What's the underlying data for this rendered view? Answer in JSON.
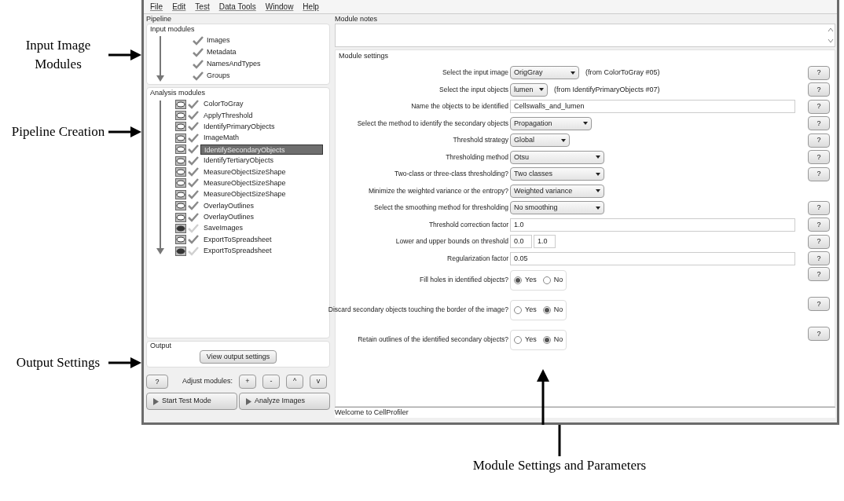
{
  "annotations": [
    {
      "text": "Input Image Modules"
    },
    {
      "text": "Pipeline Creation"
    },
    {
      "text": "Output Settings"
    },
    {
      "text": "Module Settings and Parameters"
    }
  ],
  "menu": [
    "File",
    "Edit",
    "Test",
    "Data Tools",
    "Window",
    "Help"
  ],
  "pipeline": {
    "title": "Pipeline",
    "input_title": "Input modules",
    "input_modules": [
      {
        "name": "Images"
      },
      {
        "name": "Metadata"
      },
      {
        "name": "NamesAndTypes"
      },
      {
        "name": "Groups"
      }
    ],
    "analysis_title": "Analysis modules",
    "analysis_modules": [
      {
        "name": "ColorToGray",
        "selected": false,
        "enabled": true
      },
      {
        "name": "ApplyThreshold",
        "selected": false,
        "enabled": true
      },
      {
        "name": "IdentifyPrimaryObjects",
        "selected": false,
        "enabled": true
      },
      {
        "name": "ImageMath",
        "selected": false,
        "enabled": true
      },
      {
        "name": "IdentifySecondaryObjects",
        "selected": true,
        "enabled": true
      },
      {
        "name": "IdentifyTertiaryObjects",
        "selected": false,
        "enabled": true
      },
      {
        "name": "MeasureObjectSizeShape",
        "selected": false,
        "enabled": true
      },
      {
        "name": "MeasureObjectSizeShape",
        "selected": false,
        "enabled": true
      },
      {
        "name": "MeasureObjectSizeShape",
        "selected": false,
        "enabled": true
      },
      {
        "name": "OverlayOutlines",
        "selected": false,
        "enabled": true
      },
      {
        "name": "OverlayOutlines",
        "selected": false,
        "enabled": true
      },
      {
        "name": "SaveImages",
        "selected": false,
        "enabled": false
      },
      {
        "name": "ExportToSpreadsheet",
        "selected": false,
        "enabled": true
      },
      {
        "name": "ExportToSpreadsheet",
        "selected": false,
        "enabled": false
      }
    ]
  },
  "output": {
    "title": "Output",
    "button": "View output settings"
  },
  "adjust": {
    "help": "?",
    "label": "Adjust modules:",
    "buttons": [
      "+",
      "-",
      "^",
      "v"
    ]
  },
  "run_buttons": [
    "Start Test Mode",
    "Analyze Images"
  ],
  "notes_title": "Module notes",
  "settings_title": "Module settings",
  "settings": [
    {
      "kind": "choice",
      "label": "Select the input image",
      "value": "OrigGray",
      "note": "(from ColorToGray #05)",
      "help": "?"
    },
    {
      "kind": "choice",
      "label": "Select the input objects",
      "value": "lumen",
      "note": "(from IdentifyPrimaryObjects #07)",
      "help": "?"
    },
    {
      "kind": "text",
      "label": "Name the objects to be identified",
      "value": "Cellswalls_and_lumen",
      "help": "?"
    },
    {
      "kind": "choice",
      "label": "Select the method to identify the secondary objects",
      "value": "Propagation",
      "help": "?"
    },
    {
      "kind": "choice",
      "label": "Threshold strategy",
      "value": "Global",
      "help": "?"
    },
    {
      "kind": "choice",
      "label": "Thresholding method",
      "value": "Otsu",
      "help": "?"
    },
    {
      "kind": "choice",
      "label": "Two-class or three-class thresholding?",
      "value": "Two classes",
      "help": "?"
    },
    {
      "kind": "choice",
      "label": "Minimize the weighted variance or the entropy?",
      "value": "Weighted variance"
    },
    {
      "kind": "choice",
      "label": "Select the smoothing method for thresholding",
      "value": "No smoothing",
      "help": "?"
    },
    {
      "kind": "text",
      "label": "Threshold correction factor",
      "value": "1.0",
      "help": "?"
    },
    {
      "kind": "pair",
      "label": "Lower and upper bounds on threshold",
      "values": [
        "0.0",
        "1.0"
      ],
      "help": "?"
    },
    {
      "kind": "text",
      "label": "Regularization factor",
      "value": "0.05",
      "help": "?"
    },
    {
      "kind": "radio",
      "label": "Fill holes in identified objects?",
      "options": [
        {
          "label": "Yes",
          "selected": true
        },
        {
          "label": "No",
          "selected": false
        }
      ],
      "help": "?"
    },
    {
      "kind": "radio",
      "label": "Discard secondary objects touching the border of the image?",
      "options": [
        {
          "label": "Yes",
          "selected": false
        },
        {
          "label": "No",
          "selected": true
        }
      ],
      "help": "?"
    },
    {
      "kind": "radio",
      "label": "Retain outlines of the identified secondary objects?",
      "options": [
        {
          "label": "Yes",
          "selected": false
        },
        {
          "label": "No",
          "selected": true
        }
      ],
      "help": "?"
    }
  ],
  "status_bar": "Welcome to CellProfiler"
}
